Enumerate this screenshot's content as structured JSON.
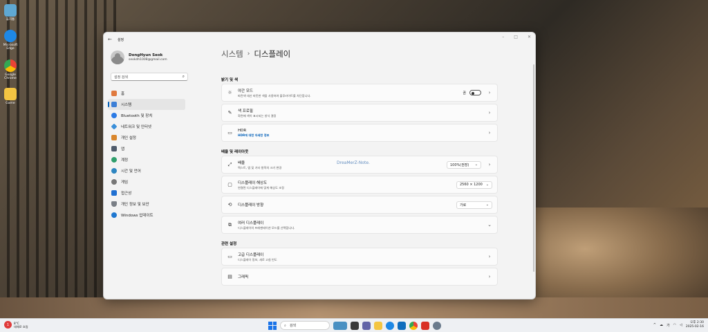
{
  "desktop": {
    "icons": [
      {
        "label": "휴지통",
        "icon": "recycle-bin-icon",
        "color": "#5fa8d3"
      },
      {
        "label": "Microsoft Edge",
        "icon": "edge-icon",
        "color": "#1e88e5"
      },
      {
        "label": "Google Chrome",
        "icon": "chrome-icon",
        "color": "#ea4335"
      },
      {
        "label": "Game",
        "icon": "folder-icon",
        "color": "#f4c542"
      }
    ],
    "watermark": "DreaMerZ-Note."
  },
  "window": {
    "title": "설정",
    "controls": {
      "minimize": "–",
      "maximize": "□",
      "close": "✕"
    }
  },
  "sidebar": {
    "user_name": "DongHyun Seok",
    "user_email": "seokdh1008@gmail.com",
    "search_placeholder": "설정 검색",
    "items": [
      {
        "label": "홈",
        "icon": "home-icon",
        "color": "#e07a3f",
        "active": false
      },
      {
        "label": "시스템",
        "icon": "system-icon",
        "color": "#3d7fd6",
        "active": true
      },
      {
        "label": "Bluetooth 및 장치",
        "icon": "bluetooth-icon",
        "color": "#2c7be5",
        "active": false
      },
      {
        "label": "네트워크 및 인터넷",
        "icon": "network-icon",
        "color": "#3a8fd9",
        "active": false
      },
      {
        "label": "개인 설정",
        "icon": "brush-icon",
        "color": "#d9862c",
        "active": false
      },
      {
        "label": "앱",
        "icon": "apps-icon",
        "color": "#4f5b6b",
        "active": false
      },
      {
        "label": "계정",
        "icon": "account-icon",
        "color": "#2f9e6d",
        "active": false
      },
      {
        "label": "시간 및 언어",
        "icon": "globe-clock-icon",
        "color": "#2e86c1",
        "active": false
      },
      {
        "label": "게임",
        "icon": "gamepad-icon",
        "color": "#777777",
        "active": false
      },
      {
        "label": "접근성",
        "icon": "accessibility-icon",
        "color": "#1f6fd1",
        "active": false
      },
      {
        "label": "개인 정보 및 보안",
        "icon": "shield-icon",
        "color": "#7a7f86",
        "active": false
      },
      {
        "label": "Windows 업데이트",
        "icon": "update-icon",
        "color": "#1f77d0",
        "active": false
      }
    ]
  },
  "main": {
    "breadcrumb_parent": "시스템",
    "breadcrumb_sep": "›",
    "breadcrumb_current": "디스플레이",
    "sections": [
      {
        "title": "밝기 및 색",
        "cards": [
          {
            "icon": "sun-icon",
            "title": "야간 모드",
            "sub": "파란색 대신 따뜻한 색을 사용하여 블루라이트를 차단합니다.",
            "control": "toggle",
            "value": "끔",
            "chevron": "›"
          },
          {
            "icon": "pen-icon",
            "title": "색 프로필",
            "sub": "화면에 색이 표시되는 방식 결정",
            "control": "none",
            "chevron": "›"
          },
          {
            "icon": "hdr-icon",
            "title": "HDR",
            "link": "HDR에 대한 자세한 정보",
            "control": "none",
            "chevron": "›"
          }
        ]
      },
      {
        "title": "배율 및 레이아웃",
        "cards": [
          {
            "icon": "scale-icon",
            "title": "배율",
            "sub": "텍스트, 앱 및 기타 항목의 크기 변경",
            "control": "dropdown",
            "value": "100%(권장)",
            "chevron": "›"
          },
          {
            "icon": "resolution-icon",
            "title": "디스플레이 해상도",
            "sub": "연결된 디스플레이에 맞게 해상도 조정",
            "control": "dropdown",
            "value": "2560 × 1200",
            "chevron": ""
          },
          {
            "icon": "orientation-icon",
            "title": "디스플레이 방향",
            "sub": "",
            "control": "dropdown",
            "value": "가로",
            "chevron": ""
          },
          {
            "icon": "multi-display-icon",
            "title": "여러 디스플레이",
            "sub": "디스플레이의 프레젠테이션 모드를 선택합니다.",
            "control": "none",
            "chevron": "⌄"
          }
        ]
      },
      {
        "title": "관련 설정",
        "cards": [
          {
            "icon": "monitor-icon",
            "title": "고급 디스플레이",
            "sub": "디스플레이 정보, 새로 고침 빈도",
            "control": "none",
            "chevron": "›"
          },
          {
            "icon": "graphics-icon",
            "title": "그래픽",
            "sub": "",
            "control": "none",
            "chevron": "›"
          }
        ]
      }
    ]
  },
  "taskbar": {
    "weather_badge": "1",
    "weather_line1": "8°C",
    "weather_line2": "대체로 흐림",
    "search_placeholder": "검색",
    "apps": [
      {
        "icon": "fish-widget-icon",
        "color": "#4a90c2"
      },
      {
        "icon": "task-view-icon",
        "color": "#3a3a3a"
      },
      {
        "icon": "chat-icon",
        "color": "#6264a7"
      },
      {
        "icon": "explorer-icon",
        "color": "#f4c542"
      },
      {
        "icon": "edge-icon",
        "color": "#1e88e5"
      },
      {
        "icon": "store-icon",
        "color": "#0f6cbd"
      },
      {
        "icon": "chrome-icon",
        "color": "#ea4335"
      },
      {
        "icon": "pdf-icon",
        "color": "#d93025"
      },
      {
        "icon": "settings-gear-icon",
        "color": "#6b7b8c"
      }
    ],
    "tray_chevron": "^",
    "ime": "가",
    "time": "오후 2:30",
    "date": "2025-02-16"
  }
}
